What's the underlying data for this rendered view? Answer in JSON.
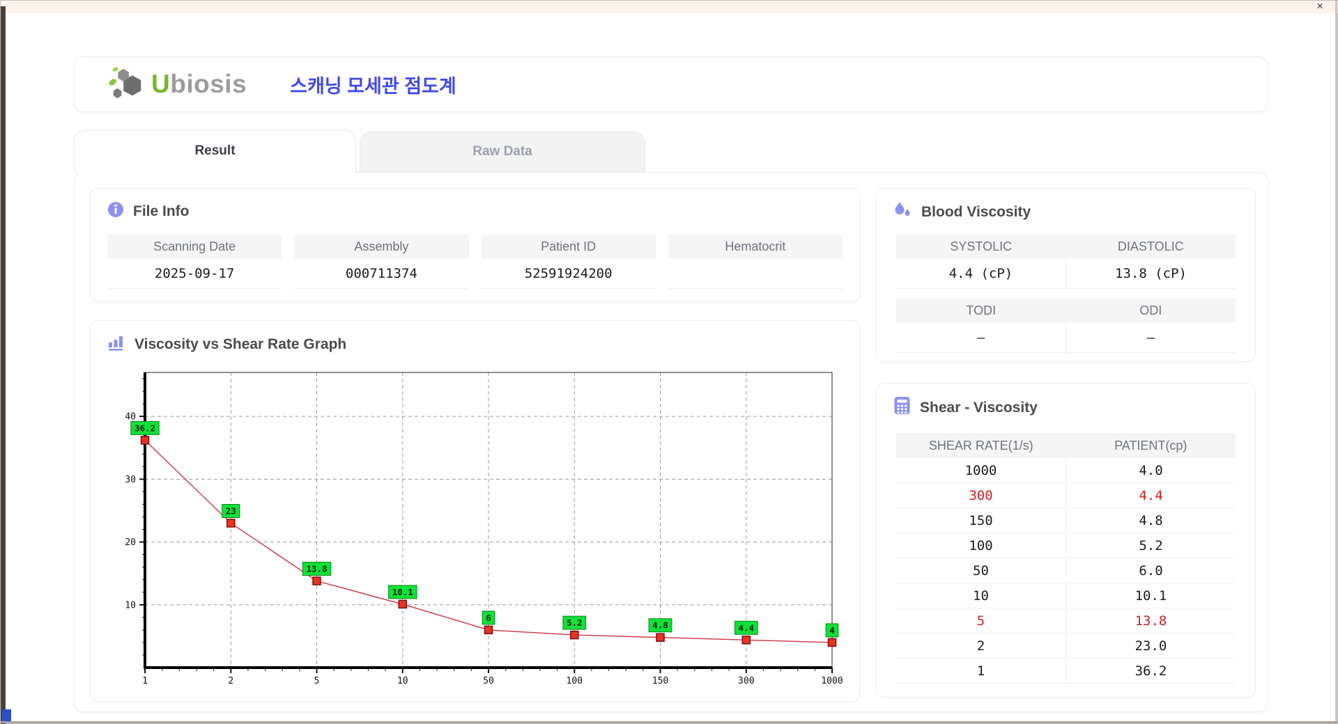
{
  "window": {
    "close_label": "×"
  },
  "header": {
    "logo": {
      "accent_text": "U",
      "rest_text": "biosis"
    },
    "app_title": "스캐닝 모세관 점도계"
  },
  "tabs": [
    {
      "label": "Result",
      "active": true
    },
    {
      "label": "Raw Data",
      "active": false
    }
  ],
  "file_info": {
    "title": "File Info",
    "fields": [
      {
        "label": "Scanning Date",
        "value": "2025-09-17"
      },
      {
        "label": "Assembly",
        "value": "000711374"
      },
      {
        "label": "Patient ID",
        "value": "52591924200"
      },
      {
        "label": "Hematocrit",
        "value": ""
      }
    ]
  },
  "blood_viscosity": {
    "title": "Blood Viscosity",
    "groups": [
      {
        "labels": [
          "SYSTOLIC",
          "DIASTOLIC"
        ],
        "values": [
          "4.4 (cP)",
          "13.8 (cP)"
        ]
      },
      {
        "labels": [
          "TODI",
          "ODI"
        ],
        "values": [
          "–",
          "–"
        ]
      }
    ]
  },
  "graph": {
    "title": "Viscosity vs Shear Rate Graph"
  },
  "chart_data": {
    "type": "line",
    "title": "Viscosity vs Shear Rate Graph",
    "x_categories": [
      "1",
      "2",
      "5",
      "10",
      "50",
      "100",
      "150",
      "300",
      "1000"
    ],
    "series": [
      {
        "name": "PATIENT(cp)",
        "values": [
          36.2,
          23,
          13.8,
          10.1,
          6,
          5.2,
          4.8,
          4.4,
          4
        ]
      }
    ],
    "point_labels": [
      "36.2",
      "23",
      "13.8",
      "10.1",
      "6",
      "5.2",
      "4.8",
      "4.4",
      "4"
    ],
    "yticks": [
      10,
      20,
      30,
      40
    ],
    "ylim": [
      0,
      47
    ],
    "y_minor_step": 2,
    "grid": "dashed",
    "legend": "none"
  },
  "shear_viscosity": {
    "title": "Shear - Viscosity",
    "columns": [
      "SHEAR RATE(1/s)",
      "PATIENT(cp)"
    ],
    "rows": [
      {
        "shear_rate": "1000",
        "patient": "4.0",
        "highlight": false
      },
      {
        "shear_rate": "300",
        "patient": "4.4",
        "highlight": true
      },
      {
        "shear_rate": "150",
        "patient": "4.8",
        "highlight": false
      },
      {
        "shear_rate": "100",
        "patient": "5.2",
        "highlight": false
      },
      {
        "shear_rate": "50",
        "patient": "6.0",
        "highlight": false
      },
      {
        "shear_rate": "10",
        "patient": "10.1",
        "highlight": false
      },
      {
        "shear_rate": "5",
        "patient": "13.8",
        "highlight": true
      },
      {
        "shear_rate": "2",
        "patient": "23.0",
        "highlight": false
      },
      {
        "shear_rate": "1",
        "patient": "36.2",
        "highlight": false
      }
    ]
  },
  "icons": {
    "window_close": "close-icon",
    "logo": "ubiosis-pebbles-logo-icon",
    "file_info": "info-circle-icon",
    "blood_viscosity": "water-drops-icon",
    "graph": "bar-chart-icon",
    "shear_viscosity": "calculator-icon"
  },
  "colors": {
    "accent_purple": "#8d92ee",
    "title_blue": "#4149e8",
    "logo_green": "#76b82a",
    "highlight_red": "#cd2127",
    "chart_line": "#cb3342",
    "chart_marker": "#e93323",
    "chart_label_bg": "#0ce237",
    "header_cell_bg": "#f5f5f6"
  }
}
